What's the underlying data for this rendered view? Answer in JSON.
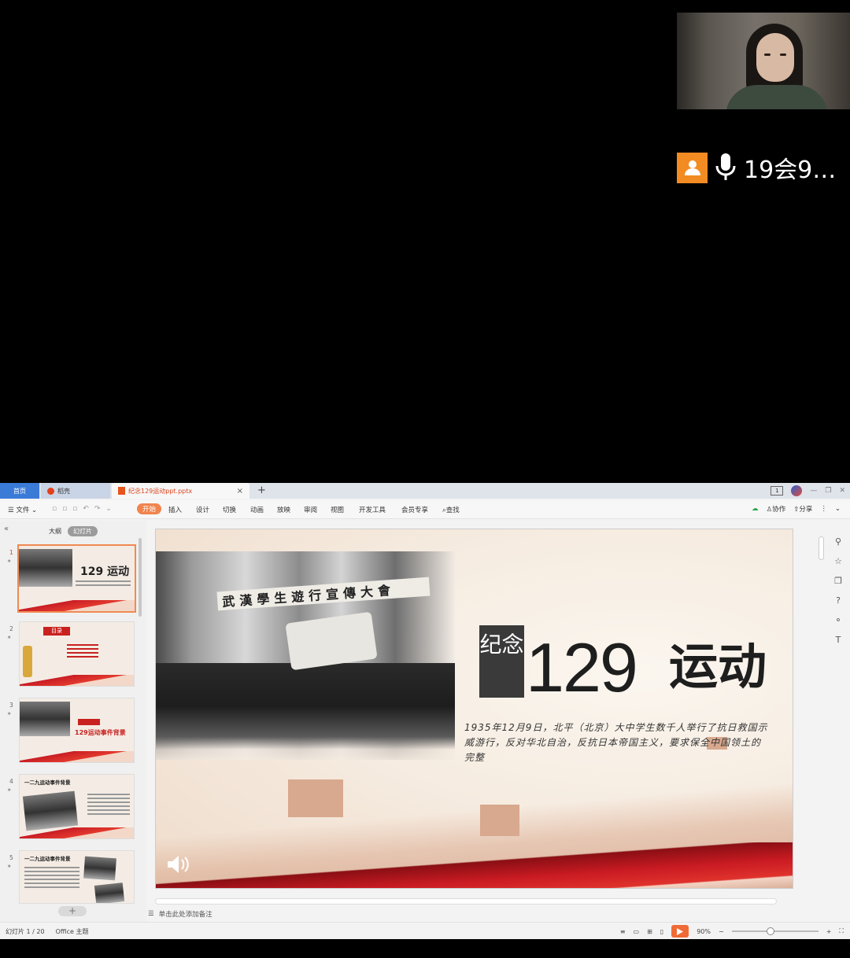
{
  "call": {
    "participant_name": "19会9…",
    "camera_label": "camera feed"
  },
  "wps": {
    "tabs": {
      "home": "首页",
      "daoke": "稻壳",
      "file": "纪念129运动ppt.pptx"
    },
    "ribbon": {
      "file_menu": "文件",
      "tabs": [
        "开始",
        "插入",
        "设计",
        "切换",
        "动画",
        "放映",
        "审阅",
        "视图",
        "开发工具",
        "会员专享"
      ],
      "search": "查找",
      "collab": "协作",
      "share": "分享"
    },
    "left_panel": {
      "outline_tab": "大纲",
      "slides_tab": "幻灯片",
      "thumbs": [
        {
          "num": "1",
          "title": "129 运动"
        },
        {
          "num": "2",
          "title": "目录"
        },
        {
          "num": "3",
          "title": "129运动事件背景"
        },
        {
          "num": "4",
          "title": "一二九运动事件背景"
        },
        {
          "num": "5",
          "title": "一二九运动事件背景"
        }
      ]
    },
    "slide": {
      "jinian": "纪念",
      "title_number": "129",
      "title_word": "运动",
      "banner_text": "武漢學生遊行宣傳大會",
      "description": "1935年12月9日，北平（北京）大中学生数千人举行了抗日救国示威游行，反对华北自治，反抗日本帝国主义，要求保全中国领土的完整"
    },
    "notes_placeholder": "单击此处添加备注",
    "status": {
      "slide_counter": "幻灯片 1 / 20",
      "theme": "Office 主题",
      "zoom": "90%",
      "zoom_fraction": 0.45
    }
  }
}
